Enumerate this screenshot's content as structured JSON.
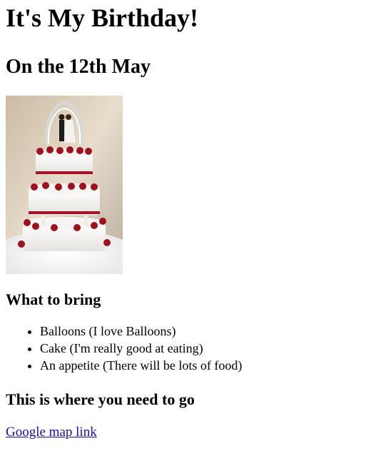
{
  "page": {
    "title": "It's My Birthday!",
    "date_heading": "On the 12th May",
    "bring_heading": "What to bring",
    "bring_items": [
      "Balloons (I love Balloons)",
      "Cake (I'm really good at eating)",
      "An appetite (There will be lots of food)"
    ],
    "location_heading": "This is where you need to go",
    "map_link": "Google map link"
  }
}
